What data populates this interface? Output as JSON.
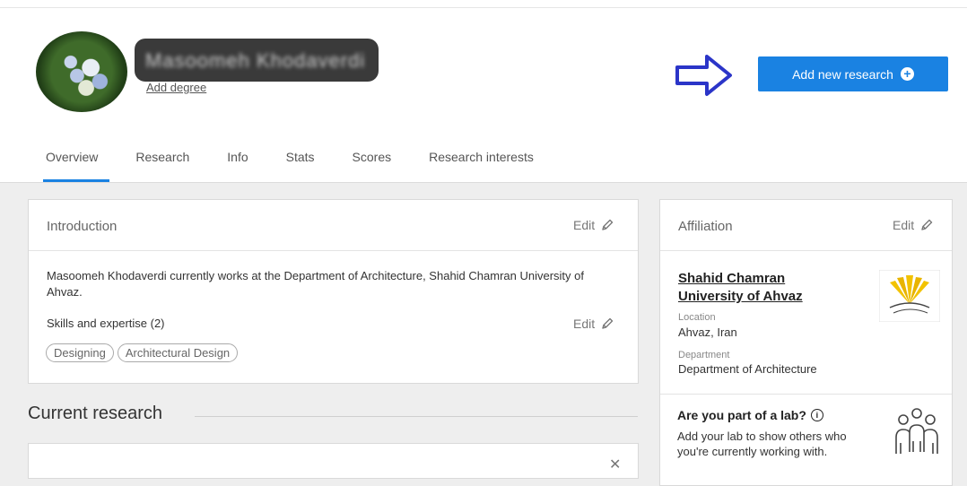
{
  "profile": {
    "name": "Masoomeh Khodaverdi",
    "add_degree": "Add degree",
    "add_research_label": "Add new research"
  },
  "tabs": [
    "Overview",
    "Research",
    "Info",
    "Stats",
    "Scores",
    "Research interests"
  ],
  "introduction": {
    "title": "Introduction",
    "edit": "Edit",
    "text": "Masoomeh Khodaverdi currently works at the Department of Architecture, Shahid Chamran University of Ahvaz.",
    "skills_title": "Skills and expertise (2)",
    "skills_edit": "Edit",
    "skills": [
      "Designing",
      "Architectural Design"
    ]
  },
  "current_research": {
    "title": "Current research"
  },
  "affiliation": {
    "title": "Affiliation",
    "edit": "Edit",
    "name": "Shahid Chamran University of Ahvaz",
    "location_label": "Location",
    "location": "Ahvaz, Iran",
    "department_label": "Department",
    "department": "Department of Architecture"
  },
  "lab": {
    "title": "Are you part of a lab?",
    "text": "Add your lab to show others who you're currently working with."
  },
  "colors": {
    "accent": "#1a82e2",
    "arrow": "#2b35c8",
    "logo_yellow": "#f2c200"
  }
}
